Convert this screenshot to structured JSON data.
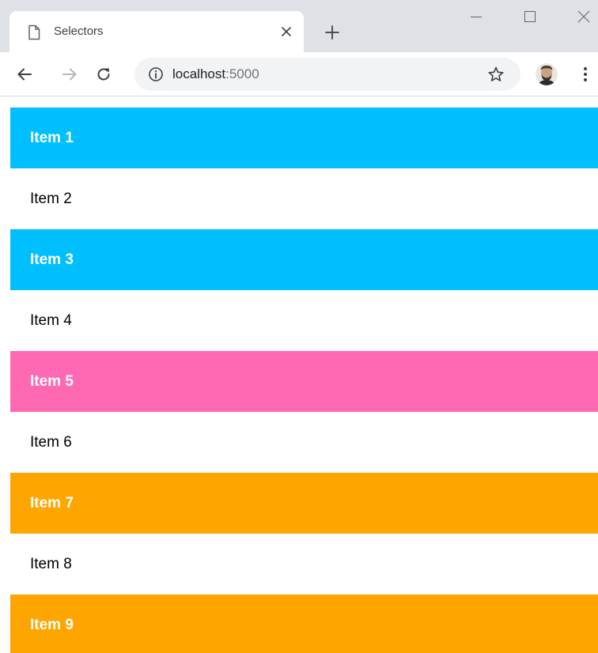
{
  "browser": {
    "tab": {
      "title": "Selectors",
      "favicon": "page-icon"
    },
    "new_tab": "plus-icon",
    "window_controls": [
      "minimize-icon",
      "maximize-icon",
      "close-icon"
    ],
    "address": {
      "info_icon": "info-icon",
      "host": "localhost",
      "port": ":5000",
      "bookmark_icon": "star-icon"
    }
  },
  "colors": {
    "blue": "#00bfff",
    "pink": "#ff69b4",
    "orange": "#ffa500",
    "white": "#ffffff"
  },
  "items": [
    {
      "label": "Item 1",
      "color": "#00bfff",
      "bold": true
    },
    {
      "label": "Item 2",
      "color": "#ffffff",
      "bold": false
    },
    {
      "label": "Item 3",
      "color": "#00bfff",
      "bold": true
    },
    {
      "label": "Item 4",
      "color": "#ffffff",
      "bold": false
    },
    {
      "label": "Item 5",
      "color": "#ff69b4",
      "bold": true
    },
    {
      "label": "Item 6",
      "color": "#ffffff",
      "bold": false
    },
    {
      "label": "Item 7",
      "color": "#ffa500",
      "bold": true
    },
    {
      "label": "Item 8",
      "color": "#ffffff",
      "bold": false
    },
    {
      "label": "Item 9",
      "color": "#ffa500",
      "bold": true
    }
  ]
}
